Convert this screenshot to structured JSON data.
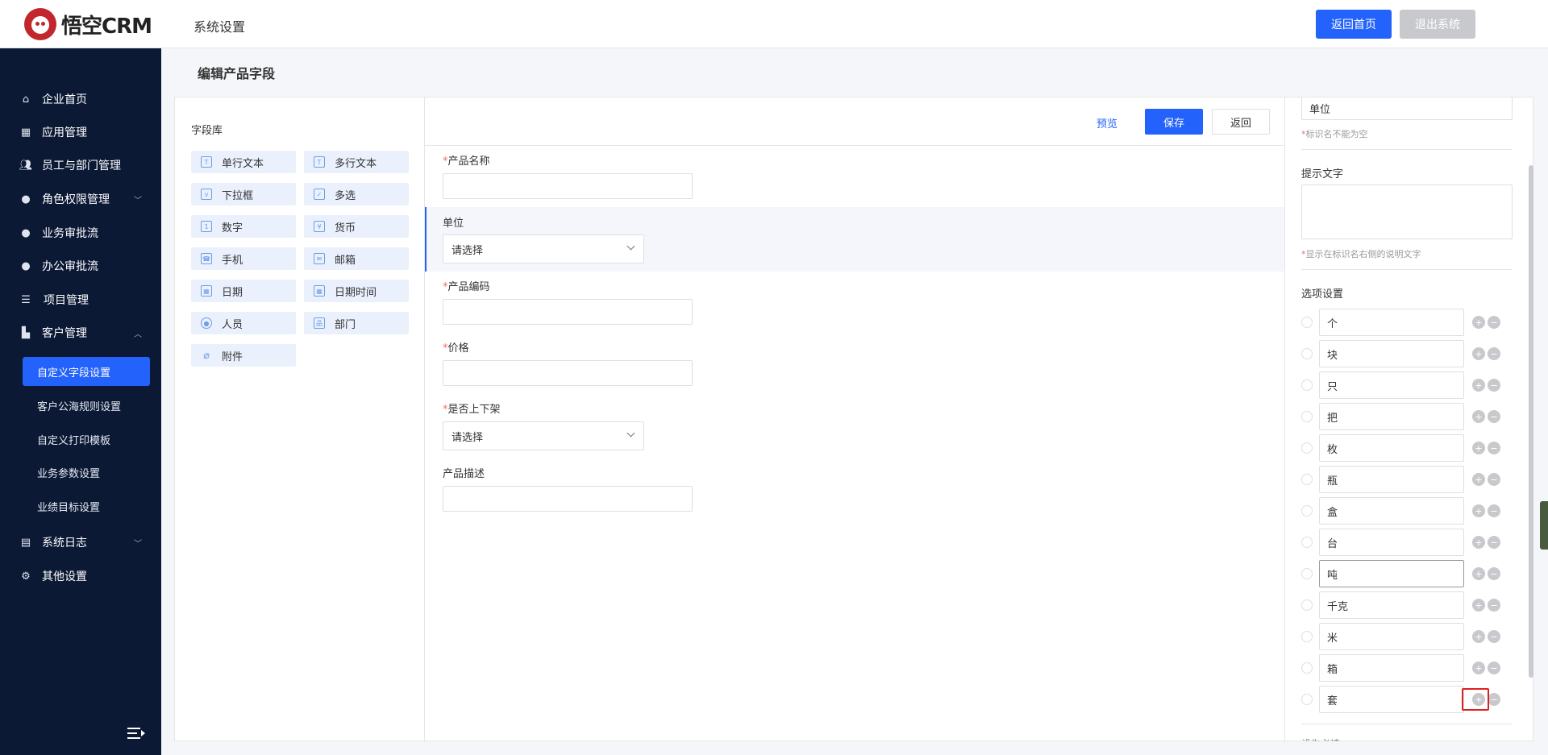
{
  "header": {
    "logo_text": "悟空CRM",
    "title": "系统设置",
    "home_button": "返回首页",
    "logout_button": "退出系统"
  },
  "sidebar": {
    "items": [
      {
        "label": "企业首页",
        "icon": "home-icon"
      },
      {
        "label": "应用管理",
        "icon": "grid-icon"
      },
      {
        "label": "员工与部门管理",
        "icon": "users-icon"
      },
      {
        "label": "角色权限管理",
        "icon": "user-icon"
      },
      {
        "label": "业务审批流",
        "icon": "user-icon"
      },
      {
        "label": "办公审批流",
        "icon": "user-icon"
      },
      {
        "label": "项目管理",
        "icon": "list-icon"
      },
      {
        "label": "客户管理",
        "icon": "building-icon"
      },
      {
        "label": "系统日志",
        "icon": "clipboard-icon"
      },
      {
        "label": "其他设置",
        "icon": "gear-icon"
      }
    ],
    "sub_items": [
      "自定义字段设置",
      "客户公海规则设置",
      "自定义打印模板",
      "业务参数设置",
      "业绩目标设置"
    ]
  },
  "page": {
    "title": "编辑产品字段"
  },
  "library": {
    "title": "字段库",
    "fields": [
      "单行文本",
      "多行文本",
      "下拉框",
      "多选",
      "数字",
      "货币",
      "手机",
      "邮箱",
      "日期",
      "日期时间",
      "人员",
      "部门",
      "附件"
    ]
  },
  "toolbar": {
    "preview": "预览",
    "save": "保存",
    "back": "返回"
  },
  "form": {
    "product_name": "产品名称",
    "unit": "单位",
    "unit_select": "请选择",
    "product_code": "产品编码",
    "price": "价格",
    "on_shelf": "是否上下架",
    "on_shelf_select": "请选择",
    "description": "产品描述",
    "required_mark": "*"
  },
  "properties": {
    "name_value": "单位",
    "name_hint": "标识名不能为空",
    "tip_title": "提示文字",
    "tip_hint": "显示在标识名右侧的说明文字",
    "options_title": "选项设置",
    "options": [
      "个",
      "块",
      "只",
      "把",
      "枚",
      "瓶",
      "盒",
      "台",
      "吨",
      "千克",
      "米",
      "箱",
      "套"
    ],
    "plus": "+",
    "minus": "−",
    "bottom_cut": "设为必填"
  }
}
